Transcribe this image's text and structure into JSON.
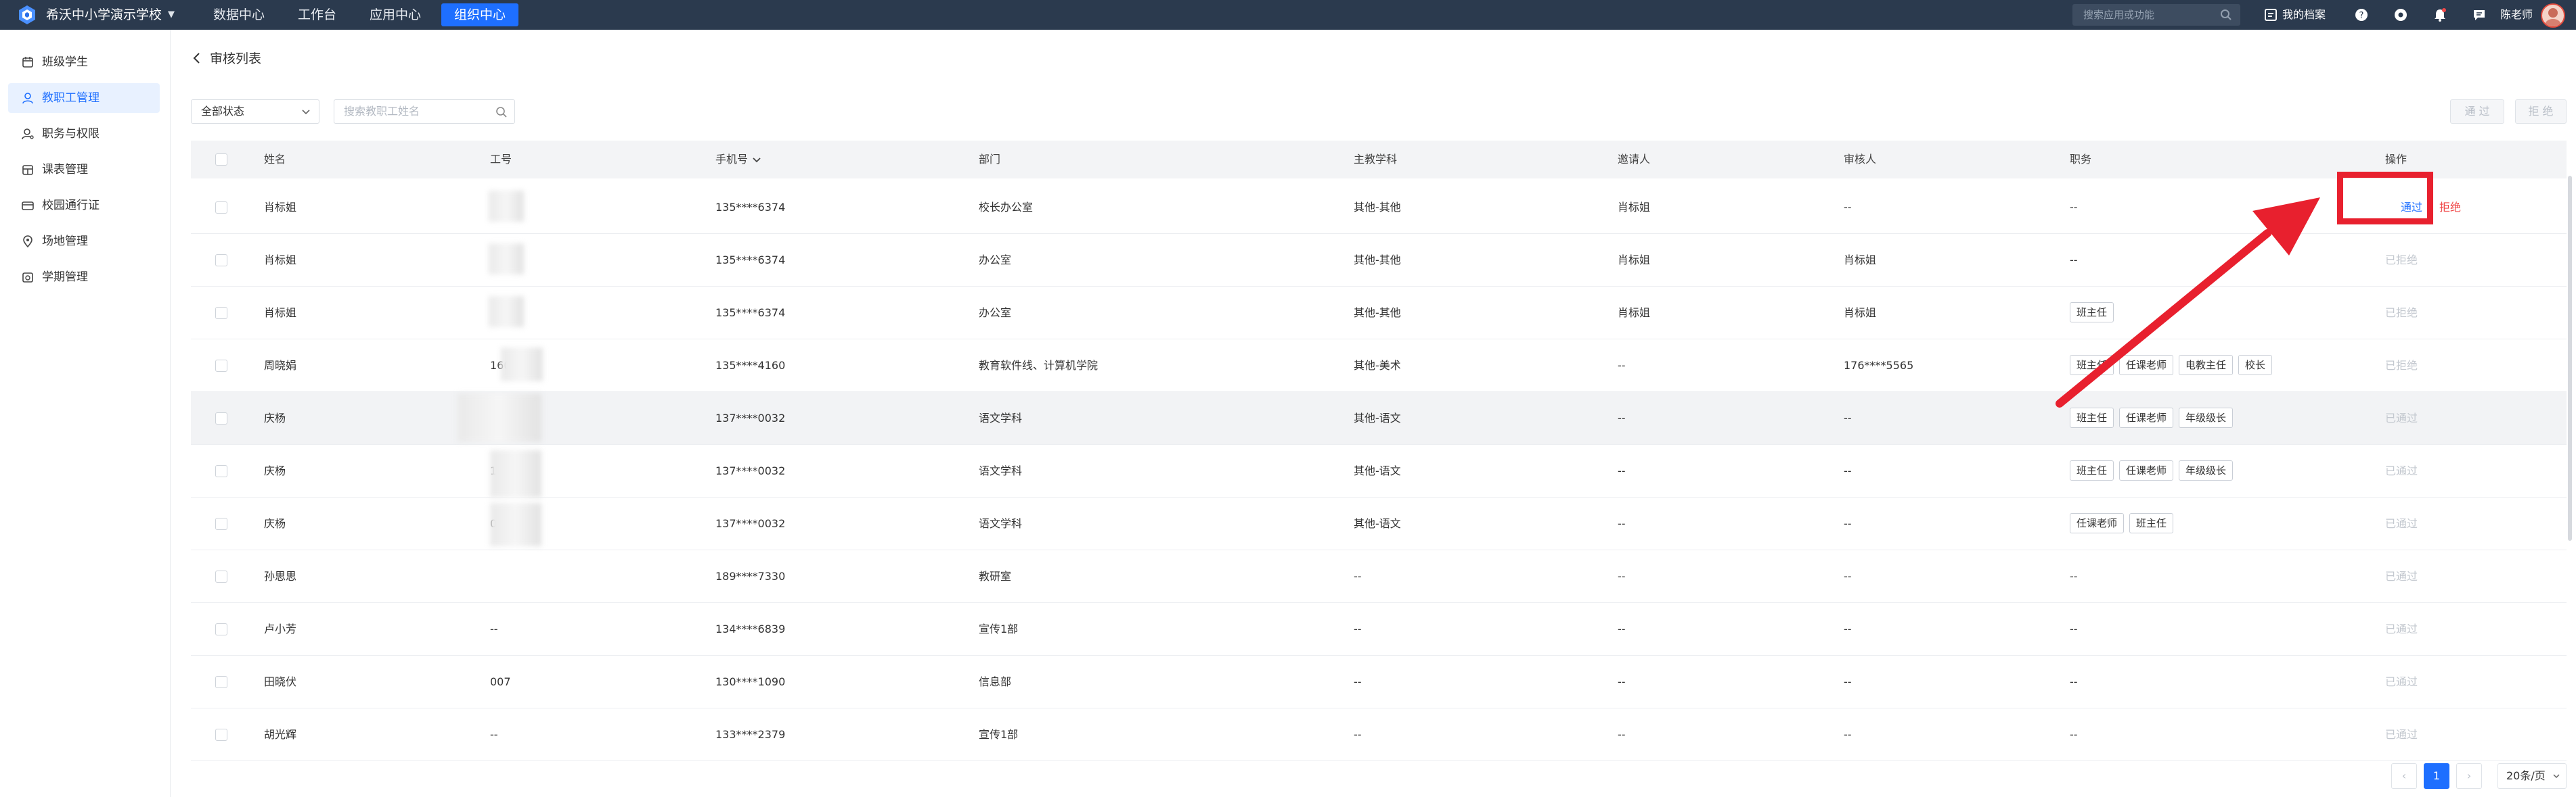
{
  "topbar": {
    "school_name": "希沃中小学演示学校",
    "nav": [
      "数据中心",
      "工作台",
      "应用中心",
      "组织中心"
    ],
    "active_nav": "组织中心",
    "search_placeholder": "搜索应用或功能",
    "archive_label": "我的档案",
    "user_name": "陈老师",
    "icons": [
      "help-icon",
      "settings-icon",
      "bell-icon",
      "message-icon"
    ]
  },
  "sidebar": {
    "items": [
      {
        "label": "班级学生",
        "icon": "calendar-icon"
      },
      {
        "label": "教职工管理",
        "icon": "user-icon",
        "active": true
      },
      {
        "label": "职务与权限",
        "icon": "user-key-icon"
      },
      {
        "label": "课表管理",
        "icon": "schedule-icon"
      },
      {
        "label": "校园通行证",
        "icon": "card-icon"
      },
      {
        "label": "场地管理",
        "icon": "location-icon"
      },
      {
        "label": "学期管理",
        "icon": "term-icon"
      }
    ]
  },
  "page": {
    "title": "审核列表",
    "status_filter": "全部状态",
    "search_placeholder": "搜索教职工姓名",
    "approve_button": "通 过",
    "reject_button": "拒 绝"
  },
  "table": {
    "headers": {
      "name": "姓名",
      "staff_no": "工号",
      "phone": "手机号",
      "dept": "部门",
      "subject": "主教学科",
      "inviter": "邀请人",
      "reviewer": "审核人",
      "duty": "职务",
      "action": "操作"
    },
    "rows": [
      {
        "name": "肖标姐",
        "staff_no": "",
        "phone": "135****6374",
        "dept": "校长办公室",
        "subject": "其他-其他",
        "inviter": "肖标姐",
        "reviewer": "--",
        "duties": [],
        "duty_text": "--",
        "actions": [
          "通过",
          "拒绝"
        ]
      },
      {
        "name": "肖标姐",
        "staff_no": "",
        "phone": "135****6374",
        "dept": "办公室",
        "subject": "其他-其他",
        "inviter": "肖标姐",
        "reviewer": "肖标姐",
        "duties": [],
        "duty_text": "--",
        "status": "已拒绝"
      },
      {
        "name": "肖标姐",
        "staff_no": "",
        "phone": "135****6374",
        "dept": "办公室",
        "subject": "其他-其他",
        "inviter": "肖标姐",
        "reviewer": "肖标姐",
        "duties": [
          "班主任"
        ],
        "duty_text": "",
        "status": "已拒绝"
      },
      {
        "name": "周晓娟",
        "staff_no": "160",
        "phone": "135****4160",
        "dept": "教育软件线、计算机学院",
        "subject": "其他-美术",
        "inviter": "--",
        "reviewer": "176****5565",
        "duties": [
          "班主任",
          "任课老师",
          "电教主任",
          "校长"
        ],
        "duty_text": "",
        "status": "已拒绝"
      },
      {
        "name": "庆杨",
        "staff_no": "137 032",
        "phone": "137****0032",
        "dept": "语文学科",
        "subject": "其他-语文",
        "inviter": "--",
        "reviewer": "--",
        "duties": [
          "班主任",
          "任课老师",
          "年级级长"
        ],
        "duty_text": "",
        "status": "已通过"
      },
      {
        "name": "庆杨",
        "staff_no": "137 032",
        "phone": "137****0032",
        "dept": "语文学科",
        "subject": "其他-语文",
        "inviter": "--",
        "reviewer": "--",
        "duties": [
          "班主任",
          "任课老师",
          "年级级长"
        ],
        "duty_text": "",
        "status": "已通过"
      },
      {
        "name": "庆杨",
        "staff_no": "032",
        "phone": "137****0032",
        "dept": "语文学科",
        "subject": "其他-语文",
        "inviter": "--",
        "reviewer": "--",
        "duties": [
          "任课老师",
          "班主任"
        ],
        "duty_text": "",
        "status": "已通过"
      },
      {
        "name": "孙思思",
        "staff_no": "",
        "phone": "189****7330",
        "dept": "教研室",
        "subject": "--",
        "inviter": "--",
        "reviewer": "--",
        "duties": [],
        "duty_text": "--",
        "status": "已通过"
      },
      {
        "name": "卢小芳",
        "staff_no": "--",
        "phone": "134****6839",
        "dept": "宣传1部",
        "subject": "--",
        "inviter": "--",
        "reviewer": "--",
        "duties": [],
        "duty_text": "--",
        "status": "已通过"
      },
      {
        "name": "田晓伏",
        "staff_no": "007",
        "phone": "130****1090",
        "dept": "信息部",
        "subject": "--",
        "inviter": "--",
        "reviewer": "--",
        "duties": [],
        "duty_text": "--",
        "status": "已通过"
      },
      {
        "name": "胡光辉",
        "staff_no": "--",
        "phone": "133****2379",
        "dept": "宣传1部",
        "subject": "--",
        "inviter": "--",
        "reviewer": "--",
        "duties": [],
        "duty_text": "--",
        "status": "已通过"
      }
    ]
  },
  "pagination": {
    "prev": "‹",
    "current": "1",
    "next": "›",
    "page_size": "20条/页"
  },
  "colors": {
    "topbar": "#2b3a4e",
    "accent": "#1e6fff",
    "danger": "#f04848",
    "annotation": "#e8202e"
  }
}
